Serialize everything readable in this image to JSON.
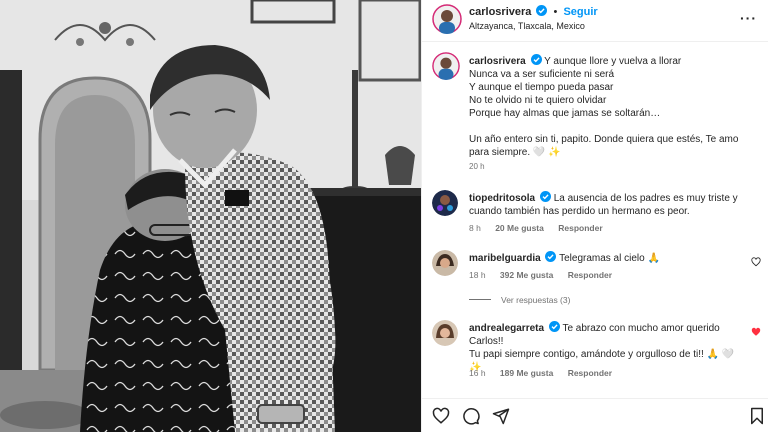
{
  "post": {
    "username": "carlosrivera",
    "follow_label": "Seguir",
    "location": "Altzayanca, Tlaxcala, Mexico",
    "more_label": "···"
  },
  "caption": {
    "username": "carlosrivera",
    "lines": [
      "Y aunque llore y vuelva a llorar",
      "Nunca va a ser suficiente ni será",
      "Y aunque el tiempo pueda pasar",
      "No te olvido ni te quiero olvidar",
      "Porque hay almas que jamas se soltarán…",
      "",
      "Un año entero sin ti, papito. Donde quiera que estés, Te amo",
      "para siempre. 🤍 ✨"
    ],
    "time": "20 h"
  },
  "comments": [
    {
      "username": "tiopedritosola",
      "verified": true,
      "text_lines": [
        "La ausencia de los padres es muy triste y",
        "cuando también has perdido un hermano es peor."
      ],
      "time": "8 h",
      "likes": "20 Me gusta",
      "reply": "Responder"
    },
    {
      "username": "maribelguardia",
      "verified": true,
      "text_lines": [
        "Telegramas al cielo 🙏"
      ],
      "time": "18 h",
      "likes": "392 Me gusta",
      "reply": "Responder",
      "view_replies": "Ver respuestas (3)"
    },
    {
      "username": "andrealegarreta",
      "verified": true,
      "text_lines": [
        "Te abrazo con mucho amor querido Carlos!!",
        "Tu papi siempre contigo, amándote y orgulloso de ti!! 🙏 🤍",
        "✨"
      ],
      "time": "16 h",
      "likes": "189 Me gusta",
      "reply": "Responder"
    }
  ],
  "colors": {
    "accent": "#0095f6",
    "text": "#262626",
    "muted": "#737373",
    "liked_heart": "#ff3040"
  },
  "icons": {
    "actions": [
      "heart-icon",
      "comment-icon",
      "share-icon",
      "bookmark-icon"
    ]
  }
}
